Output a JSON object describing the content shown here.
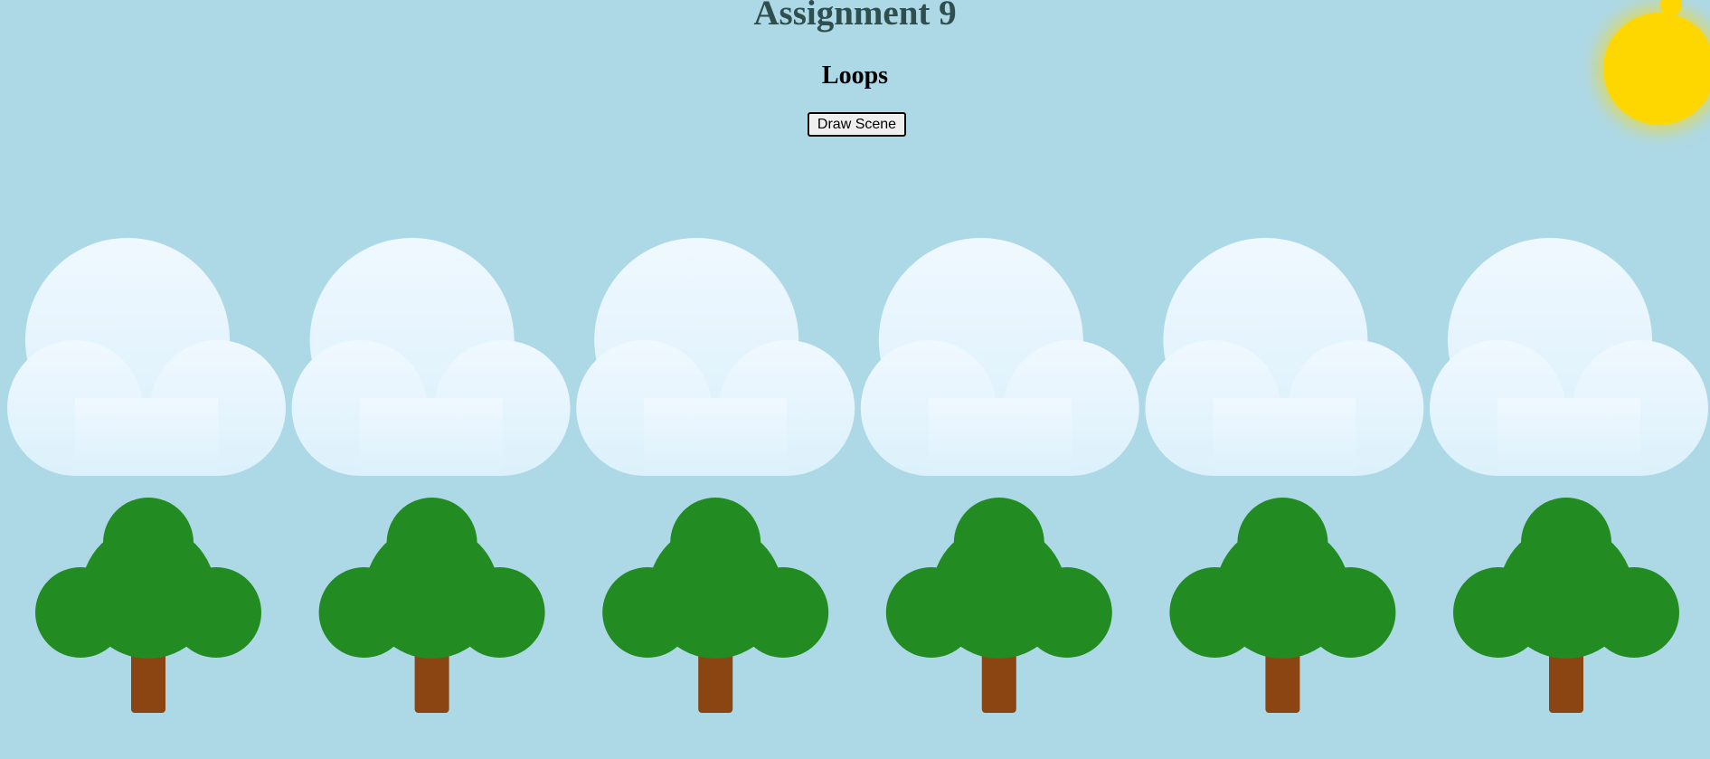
{
  "page": {
    "title": "Assignment 9",
    "subtitle": "Loops"
  },
  "controls": {
    "draw_button_label": "Draw Scene"
  },
  "scene": {
    "cloud_count": 6,
    "tree_count": 6,
    "has_sun": true
  },
  "colors": {
    "sky": "#add8e6",
    "title_text": "#2f4f4f",
    "sun": "#ffd700",
    "cloud_top": "#f0f8ff",
    "cloud_bottom": "#dbf1fb",
    "foliage": "#228b22",
    "trunk": "#8b4513"
  }
}
